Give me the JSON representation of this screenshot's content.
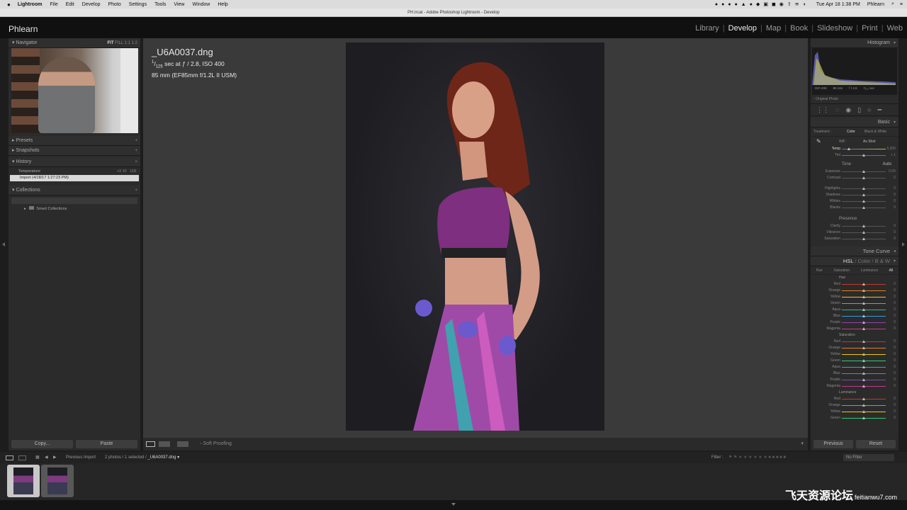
{
  "menubar": {
    "apple": "",
    "app": "Lightroom",
    "items": [
      "File",
      "Edit",
      "Develop",
      "Photo",
      "Settings",
      "Tools",
      "View",
      "Window",
      "Help"
    ],
    "clock": "Tue Apr 18  1:38 PM",
    "user": "Phlearn"
  },
  "window_title": "PH.lrcat - Adobe Photoshop Lightroom - Develop",
  "identity": "Phlearn",
  "modules": [
    "Library",
    "Develop",
    "Map",
    "Book",
    "Slideshow",
    "Print",
    "Web"
  ],
  "active_module": "Develop",
  "left_panel": {
    "navigator": {
      "title": "Navigator",
      "zoom": [
        "FIT",
        "FILL",
        "1:1",
        "1:2"
      ],
      "zoom_selected": "FIT"
    },
    "presets": {
      "title": "Presets",
      "action": "+"
    },
    "snapshots": {
      "title": "Snapshots",
      "action": "+"
    },
    "history": {
      "title": "History",
      "action": "×",
      "items": [
        {
          "label": "Temperature",
          "from": "+3 10",
          "to": "118"
        },
        {
          "label": "Import (4/18/17 1:27:23 PM)",
          "from": "",
          "to": ""
        }
      ],
      "selected": 1
    },
    "collections": {
      "title": "Collections",
      "action": "+",
      "items": [
        "Smart Collections"
      ]
    },
    "copy": "Copy...",
    "paste": "Paste"
  },
  "photo_info": {
    "filename": "_U6A0037.dng",
    "exposure_num": "1",
    "exposure_den": "125",
    "exposure_rest": " sec at ƒ / 2.8, ISO 400",
    "lens": "85 mm (EF85mm f/1.2L II USM)"
  },
  "toolbar": {
    "soft_proofing": "Soft Proofing"
  },
  "right_panel": {
    "histogram": {
      "title": "Histogram",
      "iso": "ISO 400",
      "focal": "85 mm",
      "aperture": "f / 2.8",
      "shutter": "¹⁄₁₂₅ sec",
      "original": "Original Photo"
    },
    "basic": {
      "title": "Basic",
      "treatment_label": "Treatment :",
      "treatment": [
        "Color",
        "Black & White"
      ],
      "treatment_selected": "Color",
      "wb_label": "WB :",
      "wb_value": "As Shot",
      "wb_sliders": [
        {
          "label": "Temp",
          "value": "5,000"
        },
        {
          "label": "Tint",
          "value": "+ 1"
        }
      ],
      "tone_label": "Tone",
      "auto": "Auto",
      "tone_sliders": [
        {
          "label": "Exposure",
          "value": "0.00"
        },
        {
          "label": "Contrast",
          "value": "0"
        }
      ],
      "tone2_sliders": [
        {
          "label": "Highlights",
          "value": "0"
        },
        {
          "label": "Shadows",
          "value": "0"
        },
        {
          "label": "Whites",
          "value": "0"
        },
        {
          "label": "Blacks",
          "value": "0"
        }
      ],
      "presence_label": "Presence",
      "presence_sliders": [
        {
          "label": "Clarity",
          "value": "0"
        },
        {
          "label": "Vibrance",
          "value": "0"
        },
        {
          "label": "Saturation",
          "value": "0"
        }
      ]
    },
    "tone_curve": {
      "title": "Tone Curve"
    },
    "hsl": {
      "title": "HSL",
      "sep1": "/",
      "color": "Color",
      "sep2": "/",
      "bw": "B & W",
      "tabs": [
        "Hue",
        "Saturation",
        "Luminance",
        "All"
      ],
      "tab_selected": "All",
      "hue_label": "Hue",
      "sat_label": "Saturation",
      "lum_label": "Luminance",
      "colors": [
        "Red",
        "Orange",
        "Yellow",
        "Green",
        "Aqua",
        "Blue",
        "Purple",
        "Magenta"
      ],
      "lum_colors": [
        "Red",
        "Orange",
        "Yellow",
        "Green"
      ],
      "color_hex": [
        "#c0392b",
        "#e67e22",
        "#f1c40f",
        "#2ecc71",
        "#1abc9c",
        "#3498db",
        "#8e44ad",
        "#c0398e"
      ]
    },
    "previous": "Previous",
    "reset": "Reset"
  },
  "filmstrip": {
    "source": "Previous Import",
    "count": "2 photos / 1 selected / ",
    "current": "_U6A0037.dng ▾",
    "filter_label": "Filter :",
    "filter_value": "No Filter"
  },
  "watermark": {
    "cn": "飞天资源论坛",
    "site": "feitianwu7.com"
  }
}
